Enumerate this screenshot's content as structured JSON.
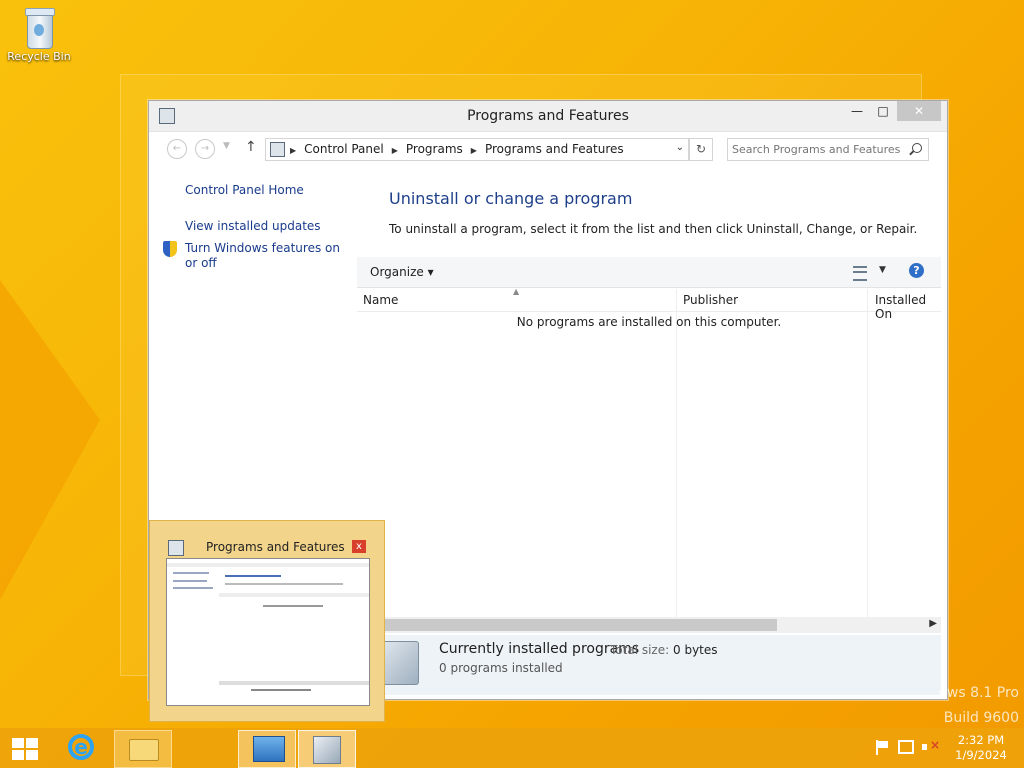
{
  "desktop": {
    "recycle_bin_label": "Recycle Bin"
  },
  "window": {
    "title": "Programs and Features",
    "minimize_glyph": "—",
    "maximize_glyph": "□",
    "close_glyph": "✕"
  },
  "address_bar": {
    "crumbs": [
      "Control Panel",
      "Programs",
      "Programs and Features"
    ],
    "search_placeholder": "Search Programs and Features"
  },
  "sidebar": {
    "home": "Control Panel Home",
    "updates": "View installed updates",
    "features": "Turn Windows features on or off"
  },
  "main": {
    "heading": "Uninstall or change a program",
    "instruction": "To uninstall a program, select it from the list and then click Uninstall, Change, or Repair.",
    "organize_label": "Organize",
    "help_glyph": "?",
    "columns": [
      "Name",
      "Publisher",
      "Installed On"
    ],
    "empty_message": "No programs are installed on this computer."
  },
  "details": {
    "title": "Currently installed programs",
    "total_size_label": "Total size:",
    "total_size_value": "0 bytes",
    "count": "0 programs installed"
  },
  "thumbnail": {
    "title": "Programs and Features",
    "close_glyph": "x"
  },
  "watermark": {
    "line1": "ows 8.1 Pro",
    "line2": "Build 9600"
  },
  "taskbar": {
    "time": "2:32 PM",
    "date": "1/9/2024"
  }
}
